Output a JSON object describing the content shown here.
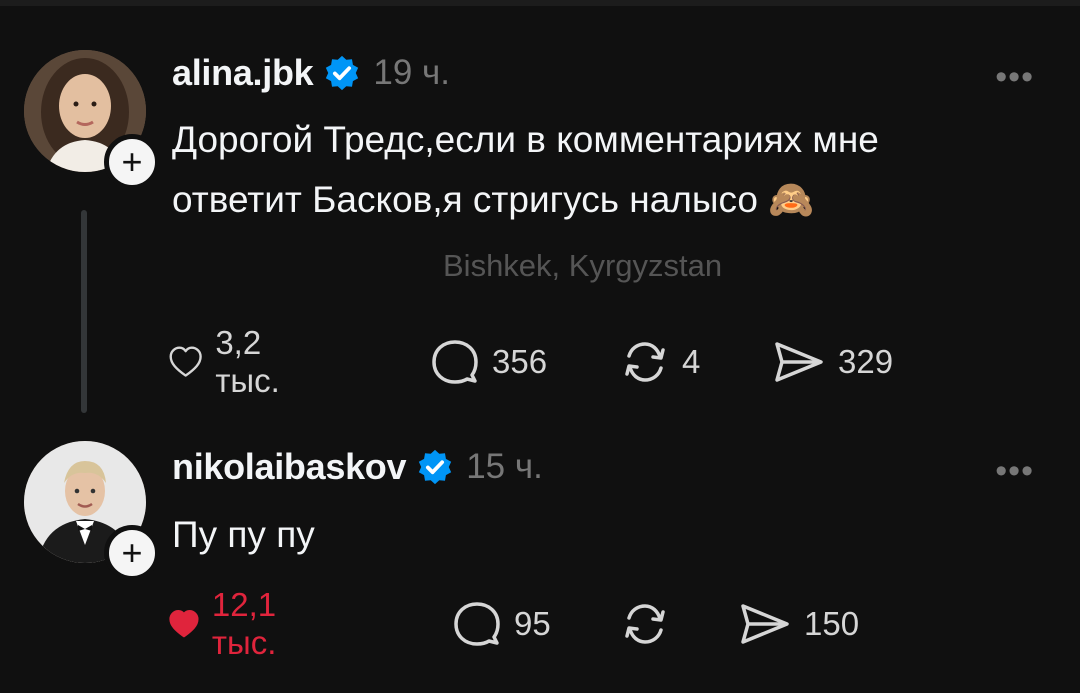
{
  "posts": [
    {
      "username": "alina.jbk",
      "time": "19 ч.",
      "text_line1": "Дорогой Тредс,если в комментариях мне",
      "text_line2": "ответит Басков,я стригусь налысо 🙈",
      "location": "Bishkek, Kyrgyzstan",
      "likes": "3,2 тыс.",
      "comments": "356",
      "reposts": "4",
      "shares": "329",
      "liked": false,
      "more": "•••",
      "follow": "+"
    },
    {
      "username": "nikolaibaskov",
      "time": "15 ч.",
      "text": "Пу пу пу",
      "likes": "12,1 тыс.",
      "comments": "95",
      "reposts": "",
      "shares": "150",
      "liked": true,
      "more": "•••",
      "follow": "+"
    }
  ],
  "colors": {
    "background": "#101010",
    "verified": "#0095f6",
    "liked": "#e0243c",
    "muted": "#777777"
  },
  "icons": [
    "verified-badge-icon",
    "heart-icon",
    "comment-icon",
    "repost-icon",
    "share-icon",
    "more-icon",
    "plus-icon"
  ]
}
